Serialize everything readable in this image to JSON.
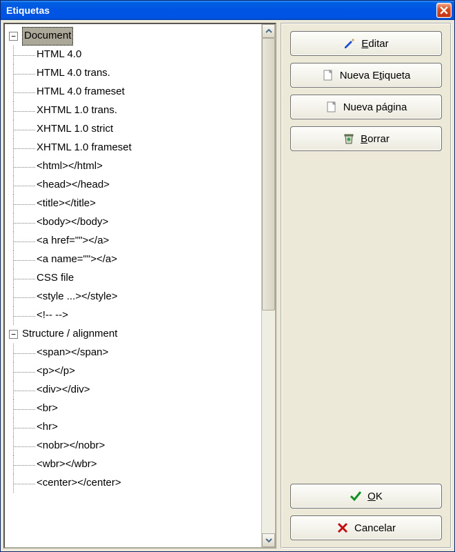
{
  "window": {
    "title": "Etiquetas"
  },
  "tree": {
    "nodes": [
      {
        "label": "Document",
        "expanded": true,
        "selected": true,
        "children": [
          "HTML 4.0",
          "HTML 4.0 trans.",
          "HTML 4.0 frameset",
          "XHTML 1.0 trans.",
          "XHTML 1.0 strict",
          "XHTML 1.0 frameset",
          "<html></html>",
          "<head></head>",
          "<title></title>",
          "<body></body>",
          "<a href=\"\"></a>",
          "<a name=\"\"></a>",
          "CSS file",
          "<style ...></style>",
          "<!-- -->"
        ]
      },
      {
        "label": "Structure / alignment",
        "expanded": true,
        "selected": false,
        "children": [
          "<span></span>",
          "<p></p>",
          "<div></div>",
          "<br>",
          "<hr>",
          "<nobr></nobr>",
          "<wbr></wbr>",
          "<center></center>"
        ]
      }
    ]
  },
  "buttons": {
    "edit": "Editar",
    "new_tag_pre": "Nueva E",
    "new_tag_u": "t",
    "new_tag_post": "iqueta",
    "new_page_pre": "Nueva pá",
    "new_page_u": "g",
    "new_page_post": "ina",
    "delete": "Borrar",
    "ok": "OK",
    "cancel": "Cancelar"
  }
}
